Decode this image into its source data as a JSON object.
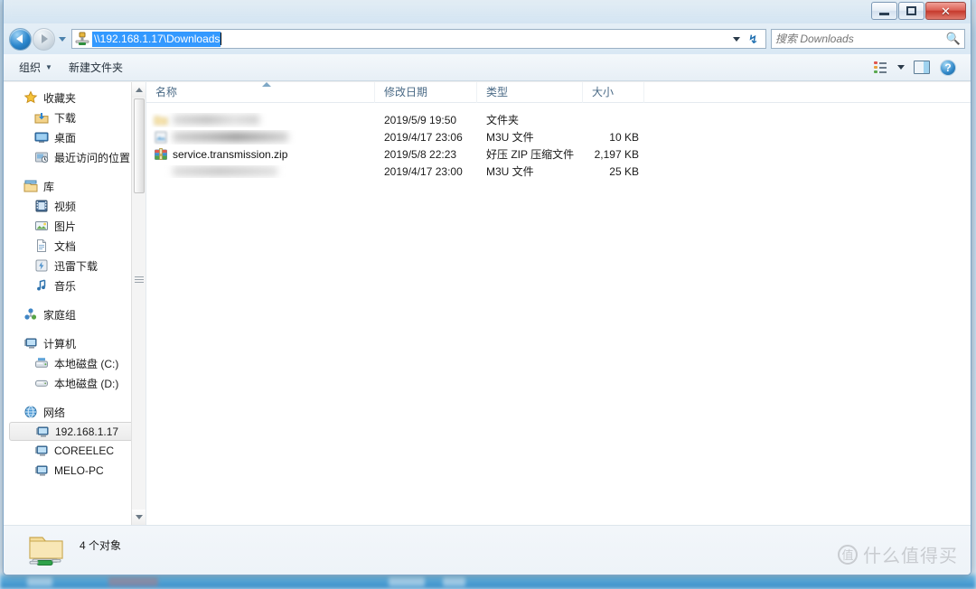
{
  "window": {
    "controls": {
      "minimize_label": "—",
      "maximize_label": "",
      "close_label": "✕"
    }
  },
  "navigation": {
    "back_name": "back-button",
    "forward_name": "forward-button",
    "recent_pages_name": "recent-pages-dropdown",
    "address": {
      "icon": "network-folder-icon",
      "value": "\\\\192.168.1.17\\Downloads",
      "selected": true
    },
    "refresh_label": "↯"
  },
  "search": {
    "placeholder": "搜索 Downloads",
    "value": "",
    "icon": "search-icon"
  },
  "toolbar": {
    "organize_label": "组织",
    "organize_caret": "▼",
    "new_folder_label": "新建文件夹",
    "view_icon": "list-view-icon",
    "view_caret": "▼",
    "preview_pane_icon": "preview-pane-icon",
    "help_label": "?"
  },
  "sidebar": {
    "groups": [
      {
        "header": {
          "label": "收藏夹",
          "icon": "star-icon"
        },
        "items": [
          {
            "label": "下载",
            "icon": "downloads-icon"
          },
          {
            "label": "桌面",
            "icon": "desktop-icon"
          },
          {
            "label": "最近访问的位置",
            "icon": "recent-places-icon"
          }
        ]
      },
      {
        "header": {
          "label": "库",
          "icon": "library-icon"
        },
        "items": [
          {
            "label": "视频",
            "icon": "video-library-icon"
          },
          {
            "label": "图片",
            "icon": "pictures-library-icon"
          },
          {
            "label": "文档",
            "icon": "documents-library-icon"
          },
          {
            "label": "迅雷下载",
            "icon": "thunder-download-icon"
          },
          {
            "label": "音乐",
            "icon": "music-library-icon"
          }
        ]
      },
      {
        "header": {
          "label": "家庭组",
          "icon": "homegroup-icon"
        },
        "items": []
      },
      {
        "header": {
          "label": "计算机",
          "icon": "computer-icon"
        },
        "items": [
          {
            "label": "本地磁盘 (C:)",
            "icon": "system-drive-icon"
          },
          {
            "label": "本地磁盘 (D:)",
            "icon": "drive-icon"
          }
        ]
      },
      {
        "header": {
          "label": "网络",
          "icon": "network-icon"
        },
        "items": [
          {
            "label": "192.168.1.17",
            "icon": "computer-icon",
            "selected": true
          },
          {
            "label": "COREELEC",
            "icon": "computer-icon"
          },
          {
            "label": "MELO-PC",
            "icon": "computer-icon"
          }
        ]
      }
    ]
  },
  "file_list": {
    "columns": [
      {
        "label": "名称",
        "sorted": "asc"
      },
      {
        "label": "修改日期"
      },
      {
        "label": "类型"
      },
      {
        "label": "大小"
      }
    ],
    "rows": [
      {
        "name": "",
        "redacted": true,
        "icon": "folder-icon",
        "date": "2019/5/9 19:50",
        "type": "文件夹",
        "size": ""
      },
      {
        "name": "",
        "redacted": true,
        "icon": "m3u-file-icon",
        "date": "2019/4/17 23:06",
        "type": "M3U 文件",
        "size": "10 KB"
      },
      {
        "name": "service.transmission.zip",
        "redacted": false,
        "icon": "zip-archive-icon",
        "date": "2019/5/8 22:23",
        "type": "好压 ZIP 压缩文件",
        "size": "2,197 KB"
      },
      {
        "name": "",
        "redacted": true,
        "icon": "m3u-file-icon",
        "date": "2019/4/17 23:00",
        "type": "M3U 文件",
        "size": "25 KB"
      }
    ]
  },
  "status_bar": {
    "icon": "network-folder-icon",
    "text": "4 个对象"
  },
  "watermark": {
    "badge": "值",
    "text": "什么值得买"
  },
  "colors": {
    "selection_blue": "#3399ff",
    "accent_blue": "#2b86cc",
    "close_red": "#c63a2d",
    "header_text": "#4a6a86"
  }
}
